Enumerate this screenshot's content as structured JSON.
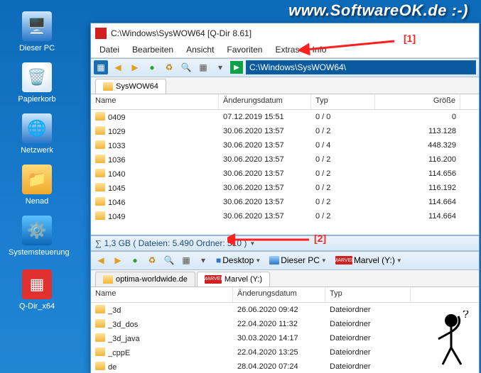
{
  "banner": "www.SoftwareOK.de :-)",
  "desktop_icons": {
    "pc": "Dieser PC",
    "bin": "Papierkorb",
    "net": "Netzwerk",
    "usr": "Nenad",
    "sys": "Systemsteuerung",
    "qdir": "Q-Dir_x64"
  },
  "window": {
    "title": "C:\\Windows\\SysWOW64  [Q-Dir 8.61]",
    "menu": {
      "datei": "Datei",
      "bearbeiten": "Bearbeiten",
      "ansicht": "Ansicht",
      "favoriten": "Favoriten",
      "extras": "Extras",
      "info": "Info"
    },
    "address_top": "C:\\Windows\\SysWOW64\\",
    "columns": {
      "name": "Name",
      "date": "Änderungsdatum",
      "type": "Typ",
      "size": "Größe"
    },
    "tab_top": "SysWOW64",
    "rows_top": [
      {
        "name": "0409",
        "date": "07.12.2019 15:51",
        "type": "0 / 0",
        "size": "0"
      },
      {
        "name": "1029",
        "date": "30.06.2020 13:57",
        "type": "0 / 2",
        "size": "113.128"
      },
      {
        "name": "1033",
        "date": "30.06.2020 13:57",
        "type": "0 / 4",
        "size": "448.329"
      },
      {
        "name": "1036",
        "date": "30.06.2020 13:57",
        "type": "0 / 2",
        "size": "116.200"
      },
      {
        "name": "1040",
        "date": "30.06.2020 13:57",
        "type": "0 / 2",
        "size": "114.656"
      },
      {
        "name": "1045",
        "date": "30.06.2020 13:57",
        "type": "0 / 2",
        "size": "116.192"
      },
      {
        "name": "1046",
        "date": "30.06.2020 13:57",
        "type": "0 / 2",
        "size": "114.664"
      },
      {
        "name": "1049",
        "date": "30.06.2020 13:57",
        "type": "0 / 2",
        "size": "114.664"
      }
    ],
    "status": "1,3 GB ( Dateien: 5.490 Ordner: 510 )",
    "toolbar2": {
      "desktop": "Desktop",
      "pc": "Dieser PC",
      "marvel": "Marvel (Y:)"
    },
    "tabs_bottom": {
      "optima": "optima-worldwide.de",
      "marvel": "Marvel (Y:)"
    },
    "rows_bottom": [
      {
        "name": "_3d",
        "date": "26.06.2020 09:42",
        "type": "Dateiordner",
        "size": ""
      },
      {
        "name": "_3d_dos",
        "date": "22.04.2020 11:32",
        "type": "Dateiordner",
        "size": ""
      },
      {
        "name": "_3d_java",
        "date": "30.03.2020 14:17",
        "type": "Dateiordner",
        "size": ""
      },
      {
        "name": "_cppE",
        "date": "22.04.2020 13:25",
        "type": "Dateiordner",
        "size": ""
      },
      {
        "name": "de",
        "date": "28.04.2020 07:24",
        "type": "Dateiordner",
        "size": ""
      }
    ]
  },
  "annotations": {
    "a1": "[1]",
    "a2": "[2]"
  }
}
